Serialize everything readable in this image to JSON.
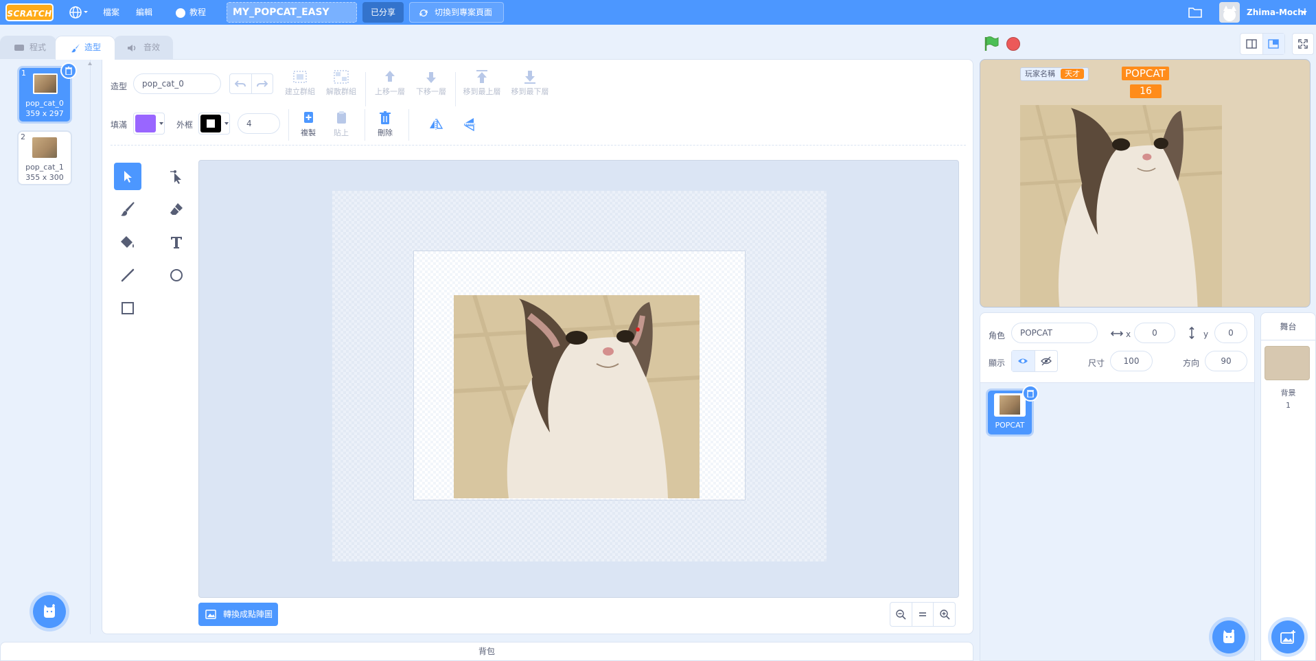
{
  "menubar": {
    "logo": "SCRATCH",
    "file": "檔案",
    "edit": "編輯",
    "tutorials": "教程",
    "project_title": "MY_POPCAT_EASY",
    "share": "已分享",
    "see_project_page": "切換到專案頁面",
    "username": "Zhima-Mochi"
  },
  "tabs": {
    "code": "程式",
    "costumes": "造型",
    "sounds": "音效"
  },
  "costumes": [
    {
      "num": "1",
      "name": "pop_cat_0",
      "size": "359 x 297"
    },
    {
      "num": "2",
      "name": "pop_cat_1",
      "size": "355 x 300"
    }
  ],
  "editor": {
    "costume_label": "造型",
    "costume_name": "pop_cat_0",
    "group": "建立群組",
    "ungroup": "解散群組",
    "forward": "上移一層",
    "backward": "下移一層",
    "front": "移到最上層",
    "back": "移到最下層",
    "fill_label": "填滿",
    "outline_label": "外框",
    "outline_width": "4",
    "copy": "複製",
    "paste": "貼上",
    "delete": "刪除",
    "convert_bitmap": "轉換成點陣圖",
    "fill_color": "#9966ff",
    "outline_color": "#000000"
  },
  "backpack": "背包",
  "stage": {
    "monitor_label": "玩家名稱",
    "monitor_value": "天才",
    "pop_title": "POPCAT",
    "pop_value": "16"
  },
  "sprite_info": {
    "sprite_label": "角色",
    "sprite_name": "POPCAT",
    "x_label": "x",
    "x_value": "0",
    "y_label": "y",
    "y_value": "0",
    "show_label": "顯示",
    "size_label": "尺寸",
    "size_value": "100",
    "direction_label": "方向",
    "direction_value": "90"
  },
  "sprites": [
    {
      "name": "POPCAT"
    }
  ],
  "stage_pane": {
    "title": "舞台",
    "backdrops_label": "背景",
    "backdrops_count": "1"
  },
  "colors": {
    "primary": "#4c97ff",
    "orange": "#ff8c1a",
    "green_flag": "#4cbf56",
    "stop": "#ec5959"
  }
}
